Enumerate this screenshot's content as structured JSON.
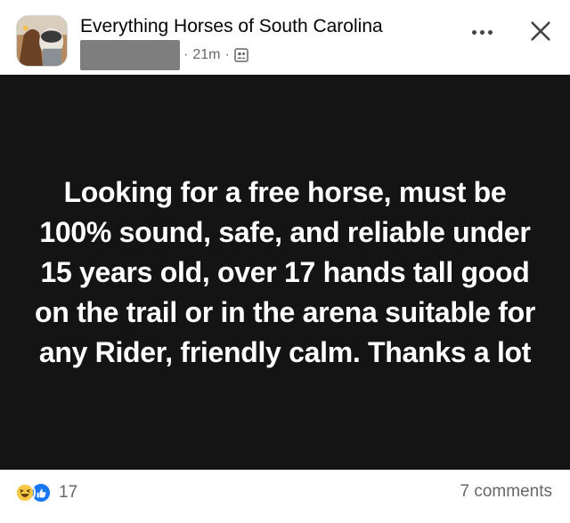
{
  "header": {
    "group_name": "Everything Horses of South Carolina",
    "time": "21m",
    "separator": "·",
    "visibility_icon": "group-members-icon",
    "more_icon": "more-options-icon",
    "close_icon": "close-icon",
    "avatar_icon": "group-avatar"
  },
  "post": {
    "background_color": "#141414",
    "text_color": "#ffffff",
    "text": "Looking for a free horse, must be 100% sound, safe, and reliable under 15 years old, over 17 hands tall good on the trail or in the arena suitable for any Rider, friendly calm. Thanks a lot"
  },
  "footer": {
    "reaction_icons": [
      "haha-emoji-icon",
      "like-icon"
    ],
    "reaction_count": "17",
    "comments": "7 comments"
  },
  "colors": {
    "like_blue": "#1877f2",
    "secondary_text": "#65676b"
  }
}
